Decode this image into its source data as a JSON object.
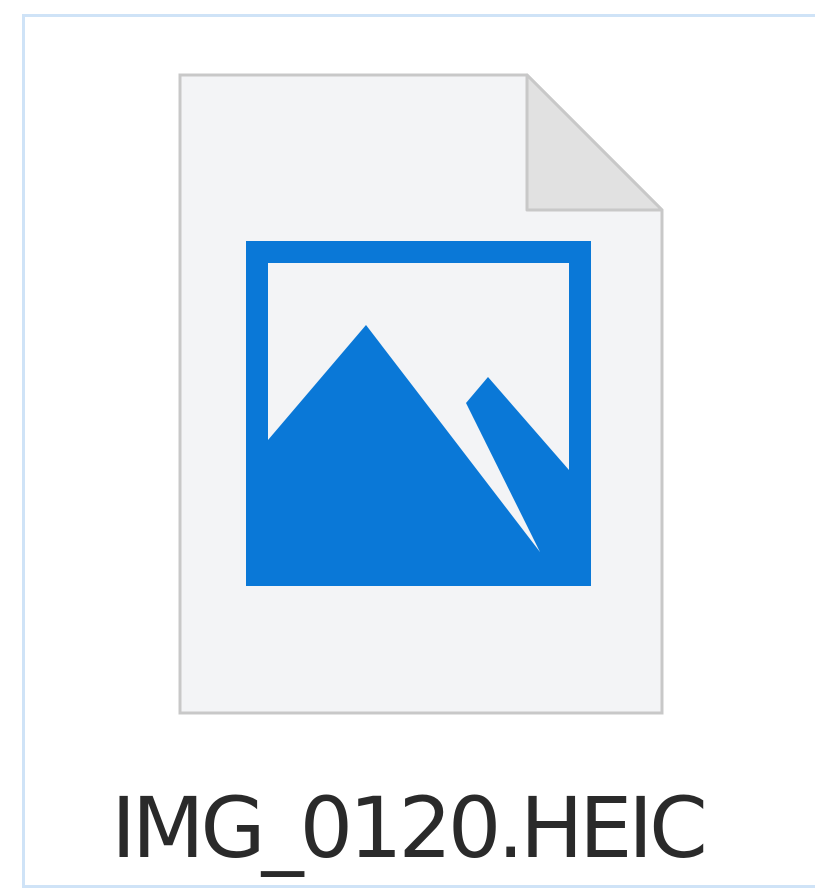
{
  "file": {
    "name": "IMG_0120.HEIC",
    "icon": "image-file-icon"
  },
  "colors": {
    "selection_border": "#cfe3f7",
    "icon_blue": "#0a78d7",
    "page_fill": "#f3f4f6",
    "page_outline": "#c8c8c8",
    "fold_fill": "#e1e1e1"
  }
}
